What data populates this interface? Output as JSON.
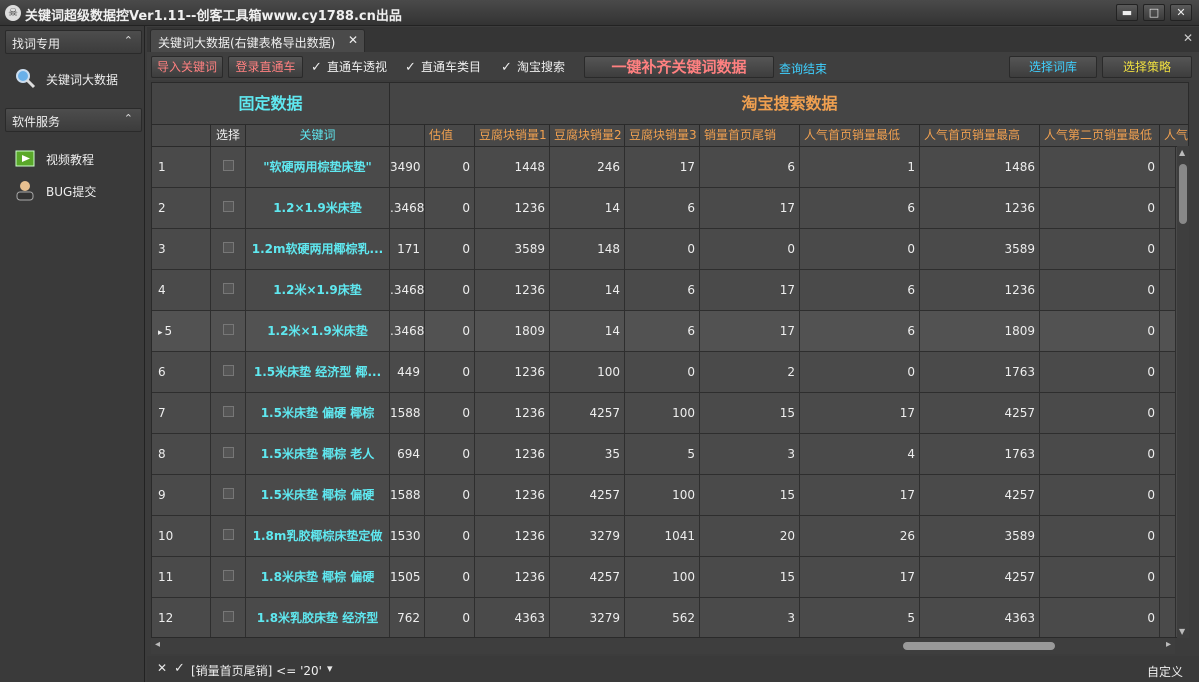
{
  "app": {
    "title": "关键词超级数据控Ver1.11--创客工具箱www.cy1788.cn出品",
    "min": "▬",
    "max": "□",
    "close": "✕"
  },
  "sidebar": {
    "sections": [
      {
        "label": "找词专用",
        "caret": "⌃"
      },
      {
        "label": "软件服务",
        "caret": "⌃"
      }
    ],
    "items": [
      {
        "label": "关键词大数据",
        "icon": "magnifier-icon"
      },
      {
        "label": "视频教程",
        "icon": "video-icon"
      },
      {
        "label": "BUG提交",
        "icon": "user-icon"
      }
    ]
  },
  "tab": {
    "label": "关键词大数据(右键表格导出数据)",
    "close": "✕"
  },
  "tabstrip_close": "✕",
  "toolbar": {
    "import": "导入关键词",
    "login": "登录直通车",
    "chk1": "直通车透视",
    "chk2": "直通车类目",
    "chk3": "淘宝搜索",
    "fill": "一键补齐关键词数据",
    "stop": "查询结束",
    "lib": "选择词库",
    "strategy": "选择策略",
    "check": "✓"
  },
  "grid": {
    "group_fixed": "固定数据",
    "group_taobao": "淘宝搜索数据",
    "col_select": "选择",
    "col_keyword": "关键词",
    "cols": [
      "",
      "估值",
      "豆腐块销量1",
      "豆腐块销量2",
      "豆腐块销量3",
      "销量首页尾销",
      "人气首页销量最低",
      "人气首页销量最高",
      "人气第二页销量最低",
      "人气"
    ],
    "sort_marker": "▼",
    "selected_marker": "▸",
    "rows": [
      {
        "idx": "1",
        "kw": "\"软硬两用棕垫床垫\"",
        "v": [
          "3490",
          "0",
          "1448",
          "246",
          "17",
          "6",
          "1",
          "1486",
          "0"
        ]
      },
      {
        "idx": "2",
        "kw": "1.2×1.9米床垫",
        "v": [
          ".3468",
          "0",
          "1236",
          "14",
          "6",
          "17",
          "6",
          "1236",
          "0"
        ]
      },
      {
        "idx": "3",
        "kw": "1.2m软硬两用椰棕乳...",
        "v": [
          "171",
          "0",
          "3589",
          "148",
          "0",
          "0",
          "0",
          "3589",
          "0"
        ]
      },
      {
        "idx": "4",
        "kw": "1.2米×1.9床垫",
        "v": [
          ".3468",
          "0",
          "1236",
          "14",
          "6",
          "17",
          "6",
          "1236",
          "0"
        ]
      },
      {
        "idx": "5",
        "kw": "1.2米×1.9米床垫",
        "v": [
          ".3468",
          "0",
          "1809",
          "14",
          "6",
          "17",
          "6",
          "1809",
          "0"
        ]
      },
      {
        "idx": "6",
        "kw": "1.5米床垫 经济型 椰...",
        "v": [
          "449",
          "0",
          "1236",
          "100",
          "0",
          "2",
          "0",
          "1763",
          "0"
        ]
      },
      {
        "idx": "7",
        "kw": "1.5米床垫 偏硬 椰棕",
        "v": [
          "1588",
          "0",
          "1236",
          "4257",
          "100",
          "15",
          "17",
          "4257",
          "0"
        ]
      },
      {
        "idx": "8",
        "kw": "1.5米床垫 椰棕 老人",
        "v": [
          "694",
          "0",
          "1236",
          "35",
          "5",
          "3",
          "4",
          "1763",
          "0"
        ]
      },
      {
        "idx": "9",
        "kw": "1.5米床垫 椰棕 偏硬",
        "v": [
          "1588",
          "0",
          "1236",
          "4257",
          "100",
          "15",
          "17",
          "4257",
          "0"
        ]
      },
      {
        "idx": "10",
        "kw": "1.8m乳胶椰棕床垫定做",
        "v": [
          "1530",
          "0",
          "1236",
          "3279",
          "1041",
          "20",
          "26",
          "3589",
          "0"
        ]
      },
      {
        "idx": "11",
        "kw": "1.8米床垫 椰棕 偏硬",
        "v": [
          "1505",
          "0",
          "1236",
          "4257",
          "100",
          "15",
          "17",
          "4257",
          "0"
        ]
      },
      {
        "idx": "12",
        "kw": "1.8米乳胶床垫 经济型",
        "v": [
          "762",
          "0",
          "4363",
          "3279",
          "562",
          "3",
          "5",
          "4363",
          "0"
        ]
      }
    ]
  },
  "filter": {
    "close": "✕",
    "check": "✓",
    "text": "[销量首页尾销] <= '20'",
    "dropdown": "▾",
    "custom": "自定义"
  },
  "scroll": {
    "up": "▲",
    "down": "▼",
    "left": "◂",
    "right": "▸"
  },
  "colors": {
    "cyan": "#5fe8f0",
    "red_label": "#ff8080",
    "header_orange": "#f0a050"
  }
}
